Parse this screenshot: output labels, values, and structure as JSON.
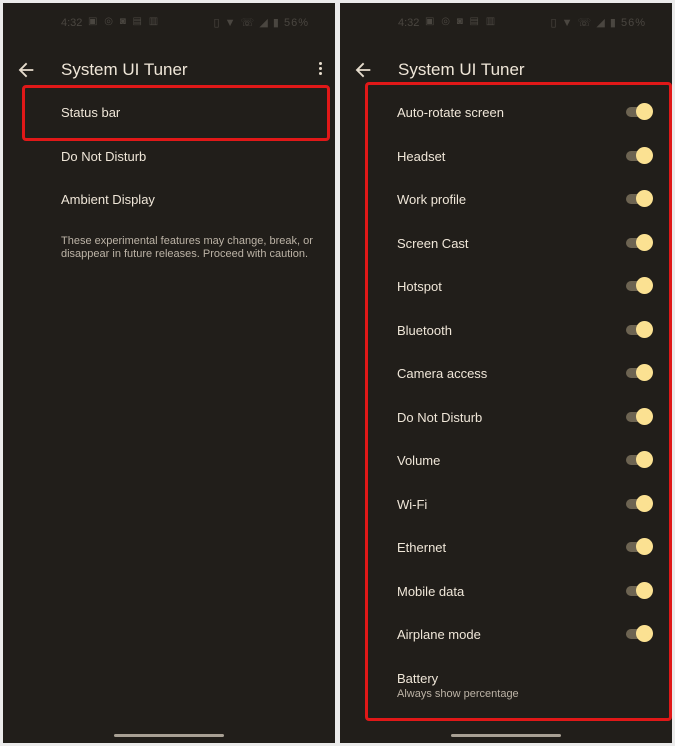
{
  "status_bar": {
    "time": "4:32",
    "notification_icons": [
      "notes-icon",
      "whatsapp-icon",
      "instagram-icon",
      "mail-icon",
      "chart-icon"
    ],
    "system_icons": [
      "vibrate-icon",
      "wifi-icon",
      "call-icon",
      "signal-icon",
      "battery-icon"
    ],
    "battery_text": "56%"
  },
  "left_screen": {
    "title": "System UI Tuner",
    "items": [
      {
        "label": "Status bar"
      },
      {
        "label": "Do Not Disturb"
      },
      {
        "label": "Ambient Display"
      }
    ],
    "info_text": "These experimental features may change, break, or disappear in future releases. Proceed with caution."
  },
  "right_screen": {
    "title": "System UI Tuner",
    "toggles": [
      {
        "label": "Auto-rotate screen",
        "on": true
      },
      {
        "label": "Headset",
        "on": true
      },
      {
        "label": "Work profile",
        "on": true
      },
      {
        "label": "Screen Cast",
        "on": true
      },
      {
        "label": "Hotspot",
        "on": true
      },
      {
        "label": "Bluetooth",
        "on": true
      },
      {
        "label": "Camera access",
        "on": true
      },
      {
        "label": "Do Not Disturb",
        "on": true
      },
      {
        "label": "Volume",
        "on": true
      },
      {
        "label": "Wi-Fi",
        "on": true
      },
      {
        "label": "Ethernet",
        "on": true
      },
      {
        "label": "Mobile data",
        "on": true
      },
      {
        "label": "Airplane mode",
        "on": true
      }
    ],
    "battery": {
      "label": "Battery",
      "subtitle": "Always show percentage"
    }
  },
  "colors": {
    "background": "#211e1a",
    "text": "#efe6d8",
    "toggle_thumb": "#fbe192",
    "toggle_track": "#6d6452",
    "highlight": "#e01818"
  }
}
